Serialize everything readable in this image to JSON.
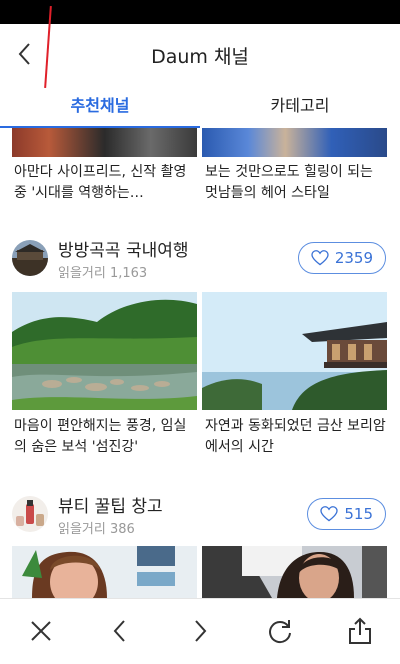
{
  "header": {
    "title": "Daum 채널"
  },
  "tabs": [
    {
      "label": "추천채널",
      "active": true
    },
    {
      "label": "카테고리",
      "active": false
    }
  ],
  "top_articles": [
    {
      "caption": "아만다 사이프리드, 신작 촬영 중 '시대를 역행하는…"
    },
    {
      "caption": "보는 것만으로도 힐링이 되는 멋남들의 헤어 스타일"
    }
  ],
  "channels": [
    {
      "name": "방방곡곡 국내여행",
      "reads_label": "읽을거리",
      "reads_count": "1,163",
      "likes": "2359",
      "articles": [
        {
          "caption": "마음이 편안해지는 풍경, 임실의 숨은 보석 '섬진강'"
        },
        {
          "caption": "자연과 동화되었던 금산 보리암에서의 시간"
        }
      ]
    },
    {
      "name": "뷰티 꿀팁 창고",
      "reads_label": "읽을거리",
      "reads_count": "386",
      "likes": "515",
      "articles": []
    }
  ],
  "toolbar": [
    "close-icon",
    "back-arrow-icon",
    "forward-arrow-icon",
    "refresh-icon",
    "share-icon"
  ],
  "colors": {
    "accent": "#2a6be0",
    "like_border": "#5c8ee0"
  }
}
